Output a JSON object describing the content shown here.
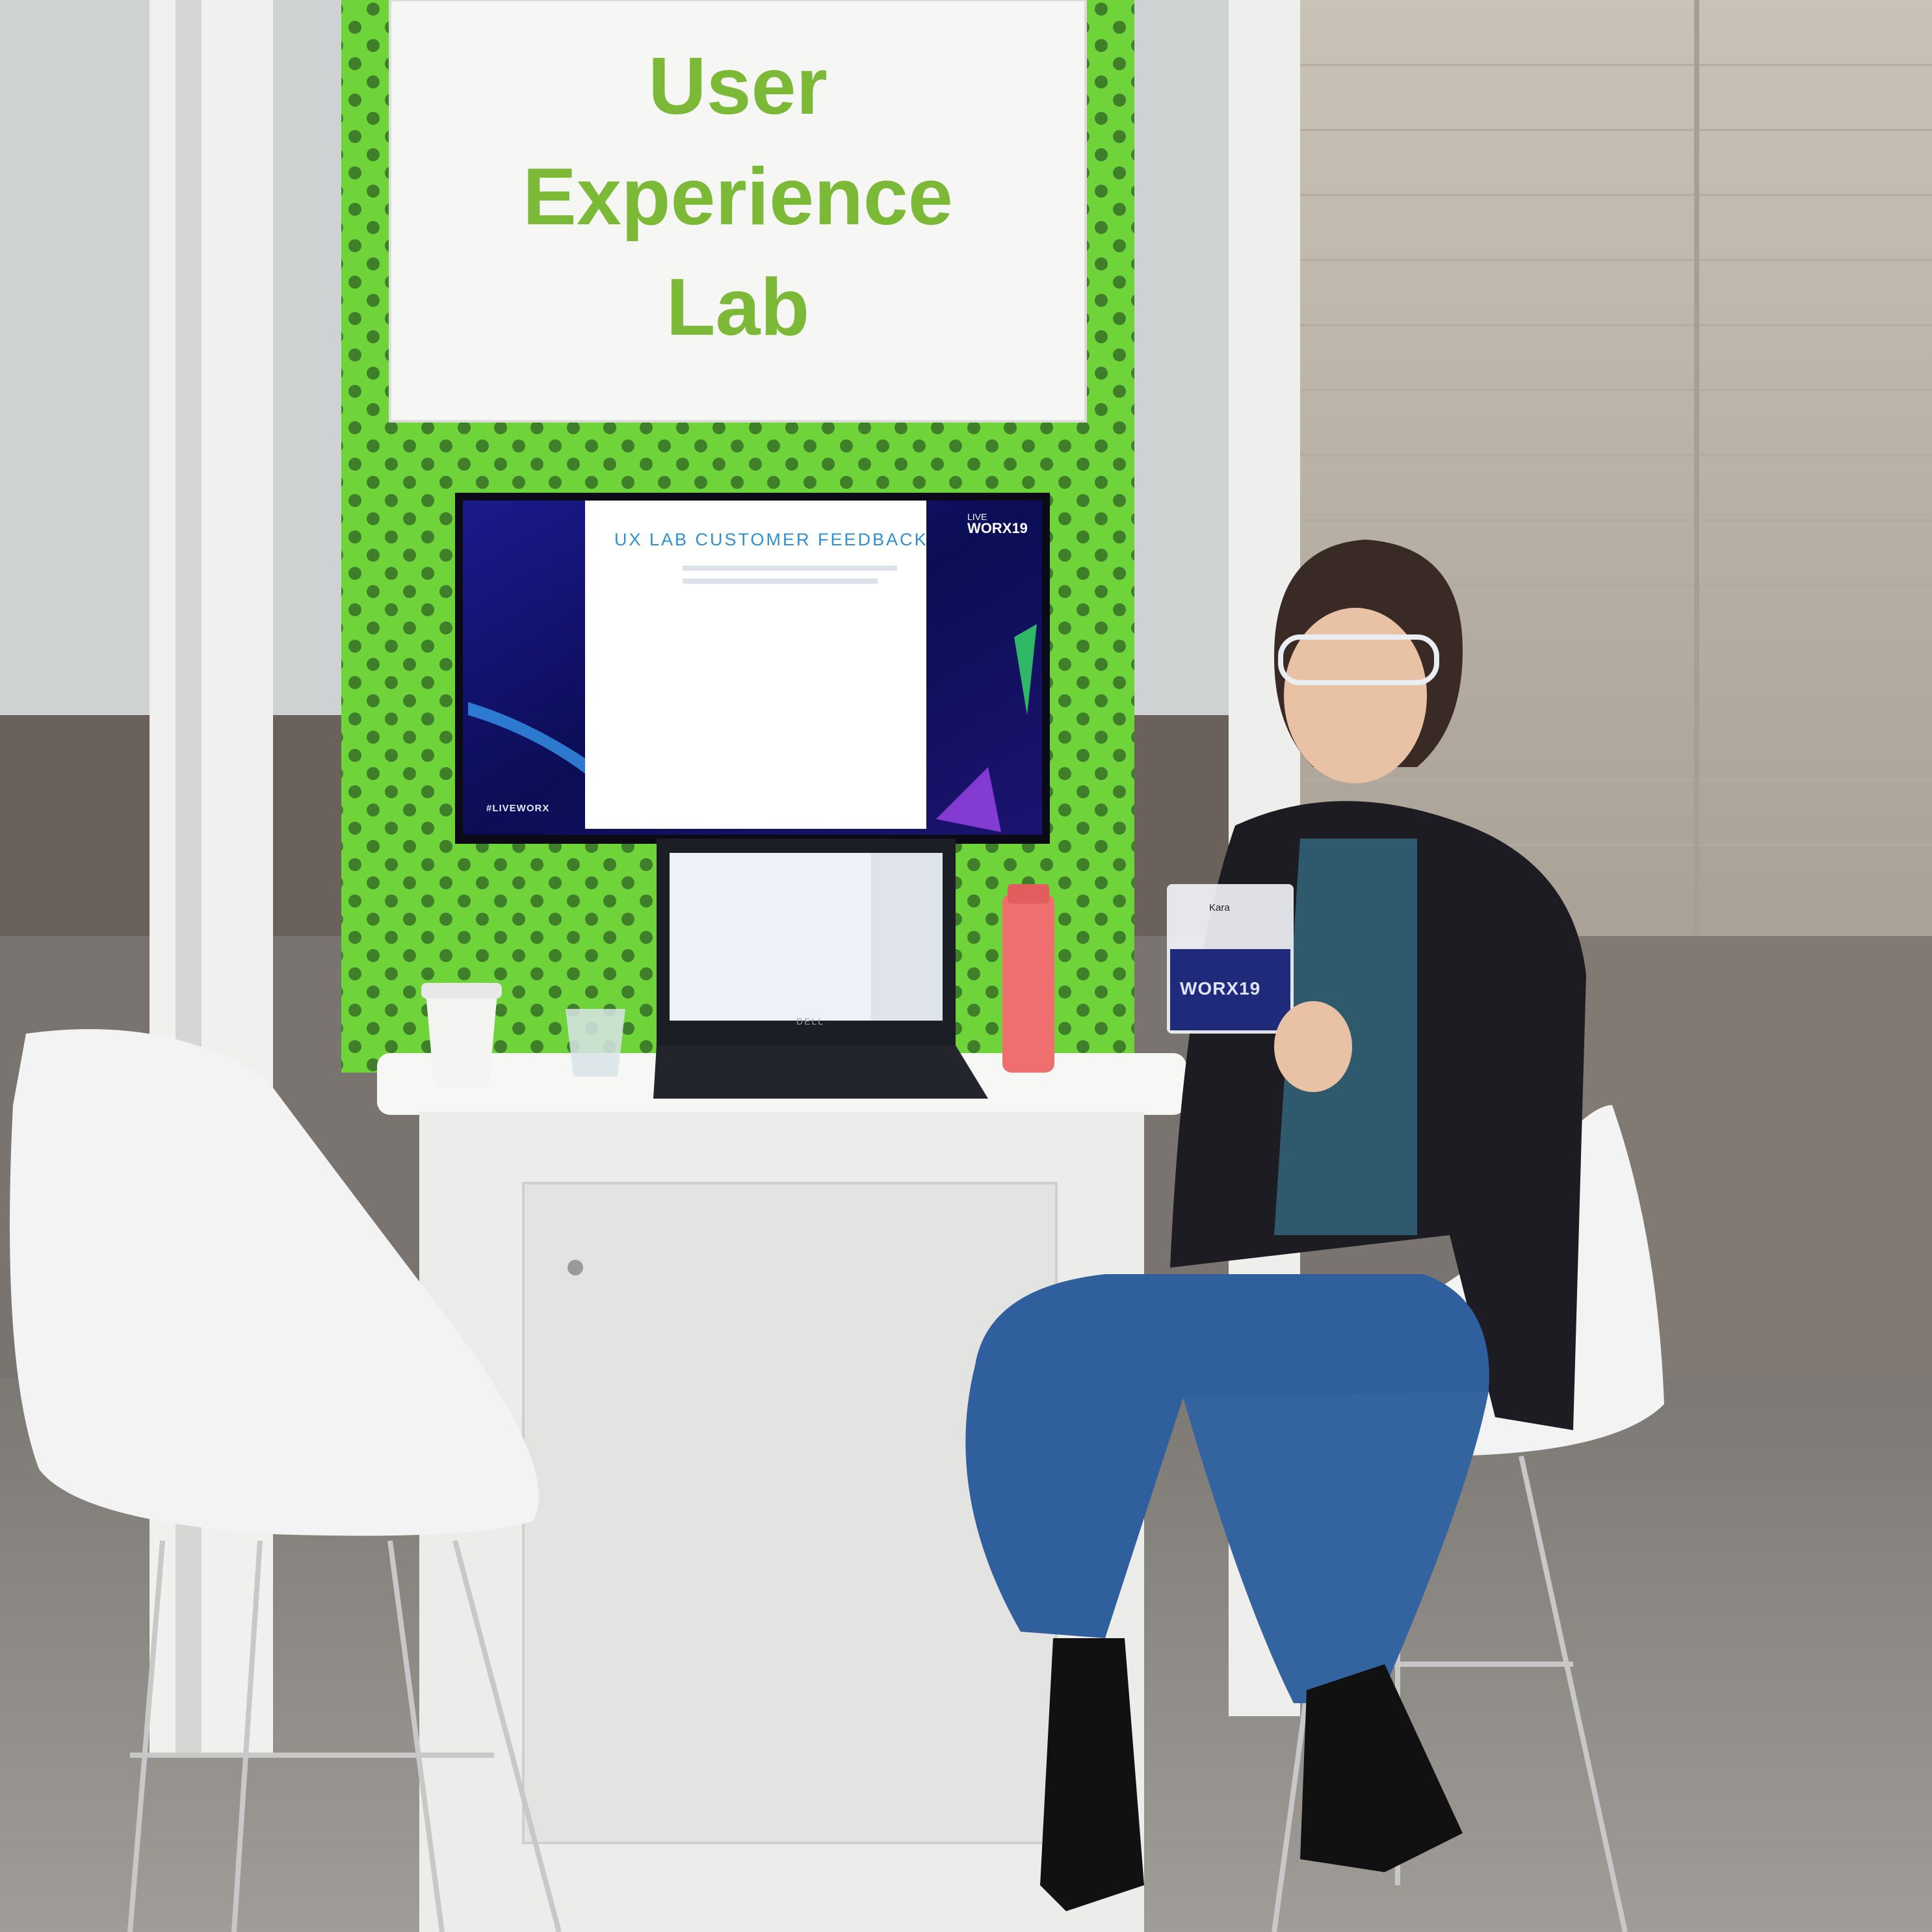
{
  "sign": {
    "line1": "User",
    "line2": "Experience",
    "line3": "Lab"
  },
  "monitor": {
    "slide_title": "UX LAB CUSTOMER FEEDBACK",
    "hashtag": "#LIVEWORX",
    "logo_line1": "LIVE",
    "logo_line2": "WORX19"
  },
  "badge": {
    "name": "Kara",
    "event_logo": "WORX19"
  },
  "laptop": {
    "brand": "DELL"
  },
  "colors": {
    "brand_green": "#7cb936",
    "panel_green": "#6dcf37",
    "sign_text_green": "#7cb936"
  }
}
